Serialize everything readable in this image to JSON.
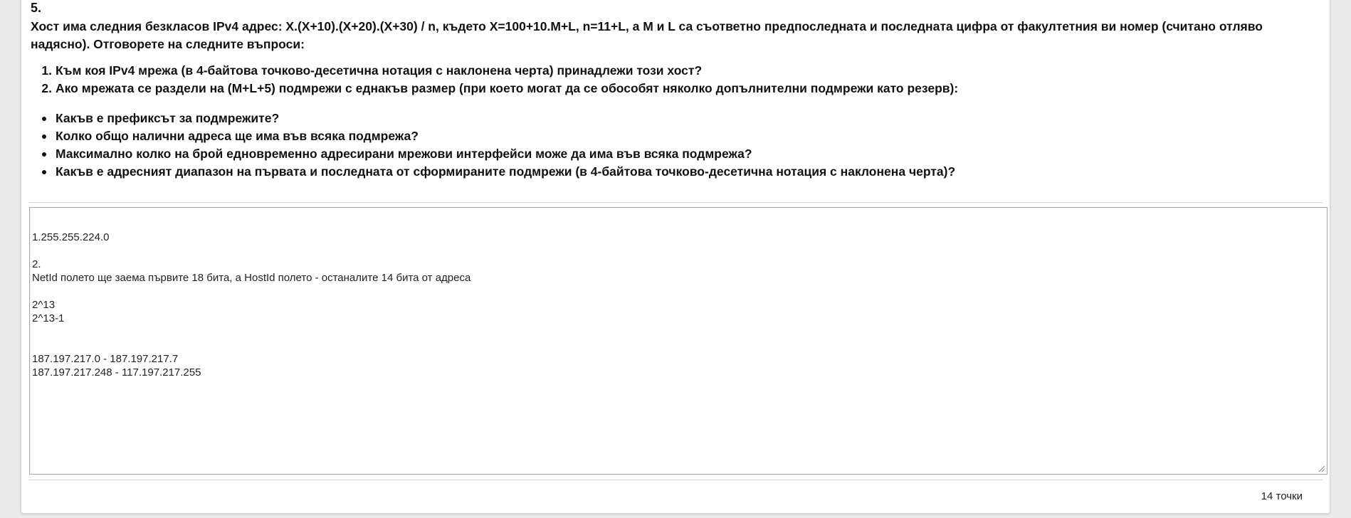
{
  "question": {
    "number": "5.",
    "text": "Хост има следния безкласов IPv4 адрес: X.(X+10).(X+20).(X+30) / n, където X=100+10.M+L, n=11+L, а M и L са съответно предпоследната и последната цифра от факултетния ви номер (считано отляво надясно). Отговорете на следните въпроси:",
    "ordered_items": [
      {
        "num": "1.",
        "text": "Към коя IPv4 мрежа (в 4-байтова точково-десетична нотация с наклонена черта) принадлежи този хост?"
      },
      {
        "num": "2.",
        "text": "Ако мрежата се раздели на (M+L+5) подмрежи с еднакъв размер (при което могат да се обособят няколко допълнителни подмрежи като резерв):"
      }
    ],
    "bullet_items": [
      "Какъв е префиксът за подмрежите?",
      "Колко общо налични адреса ще има във всяка подмрежа?",
      "Максимално колко на брой едновременно адресирани мрежови интерфейси може да има във всяка подмрежа?",
      "Какъв е адресният диапазон на първата и последната от сформираните подмрежи (в 4-байтова точково-десетична нотация с наклонена черта)?"
    ]
  },
  "answer": {
    "value": "1.255.255.224.0\n\n2.\nNetId полето ще заема първите 18 бита, а HostId полето - останалите 14 бита от адреса\n\n2^13\n2^13-1\n\n\n187.197.217.0 - 187.197.217.7\n187.197.217.248 - 117.197.217.255"
  },
  "footer": {
    "points": "14 точки"
  }
}
